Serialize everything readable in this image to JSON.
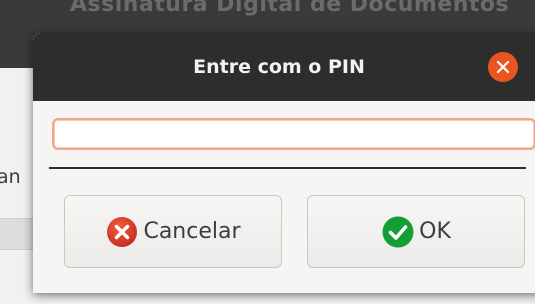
{
  "background_window": {
    "title": "Assinatura Digital de Documentos",
    "side_text": "an"
  },
  "dialog": {
    "title": "Entre com o PIN",
    "close_icon": "close-icon",
    "pin_field": {
      "value": "",
      "placeholder": ""
    },
    "buttons": {
      "cancel_label": "Cancelar",
      "cancel_icon": "cancel-icon",
      "ok_label": "OK",
      "ok_icon": "checkmark-icon"
    }
  },
  "colors": {
    "accent": "#e95420",
    "header_bg": "#2d2d2d",
    "cancel_icon": "#c7162b",
    "ok_icon": "#0e8420",
    "input_focus_border": "#f0a888"
  }
}
